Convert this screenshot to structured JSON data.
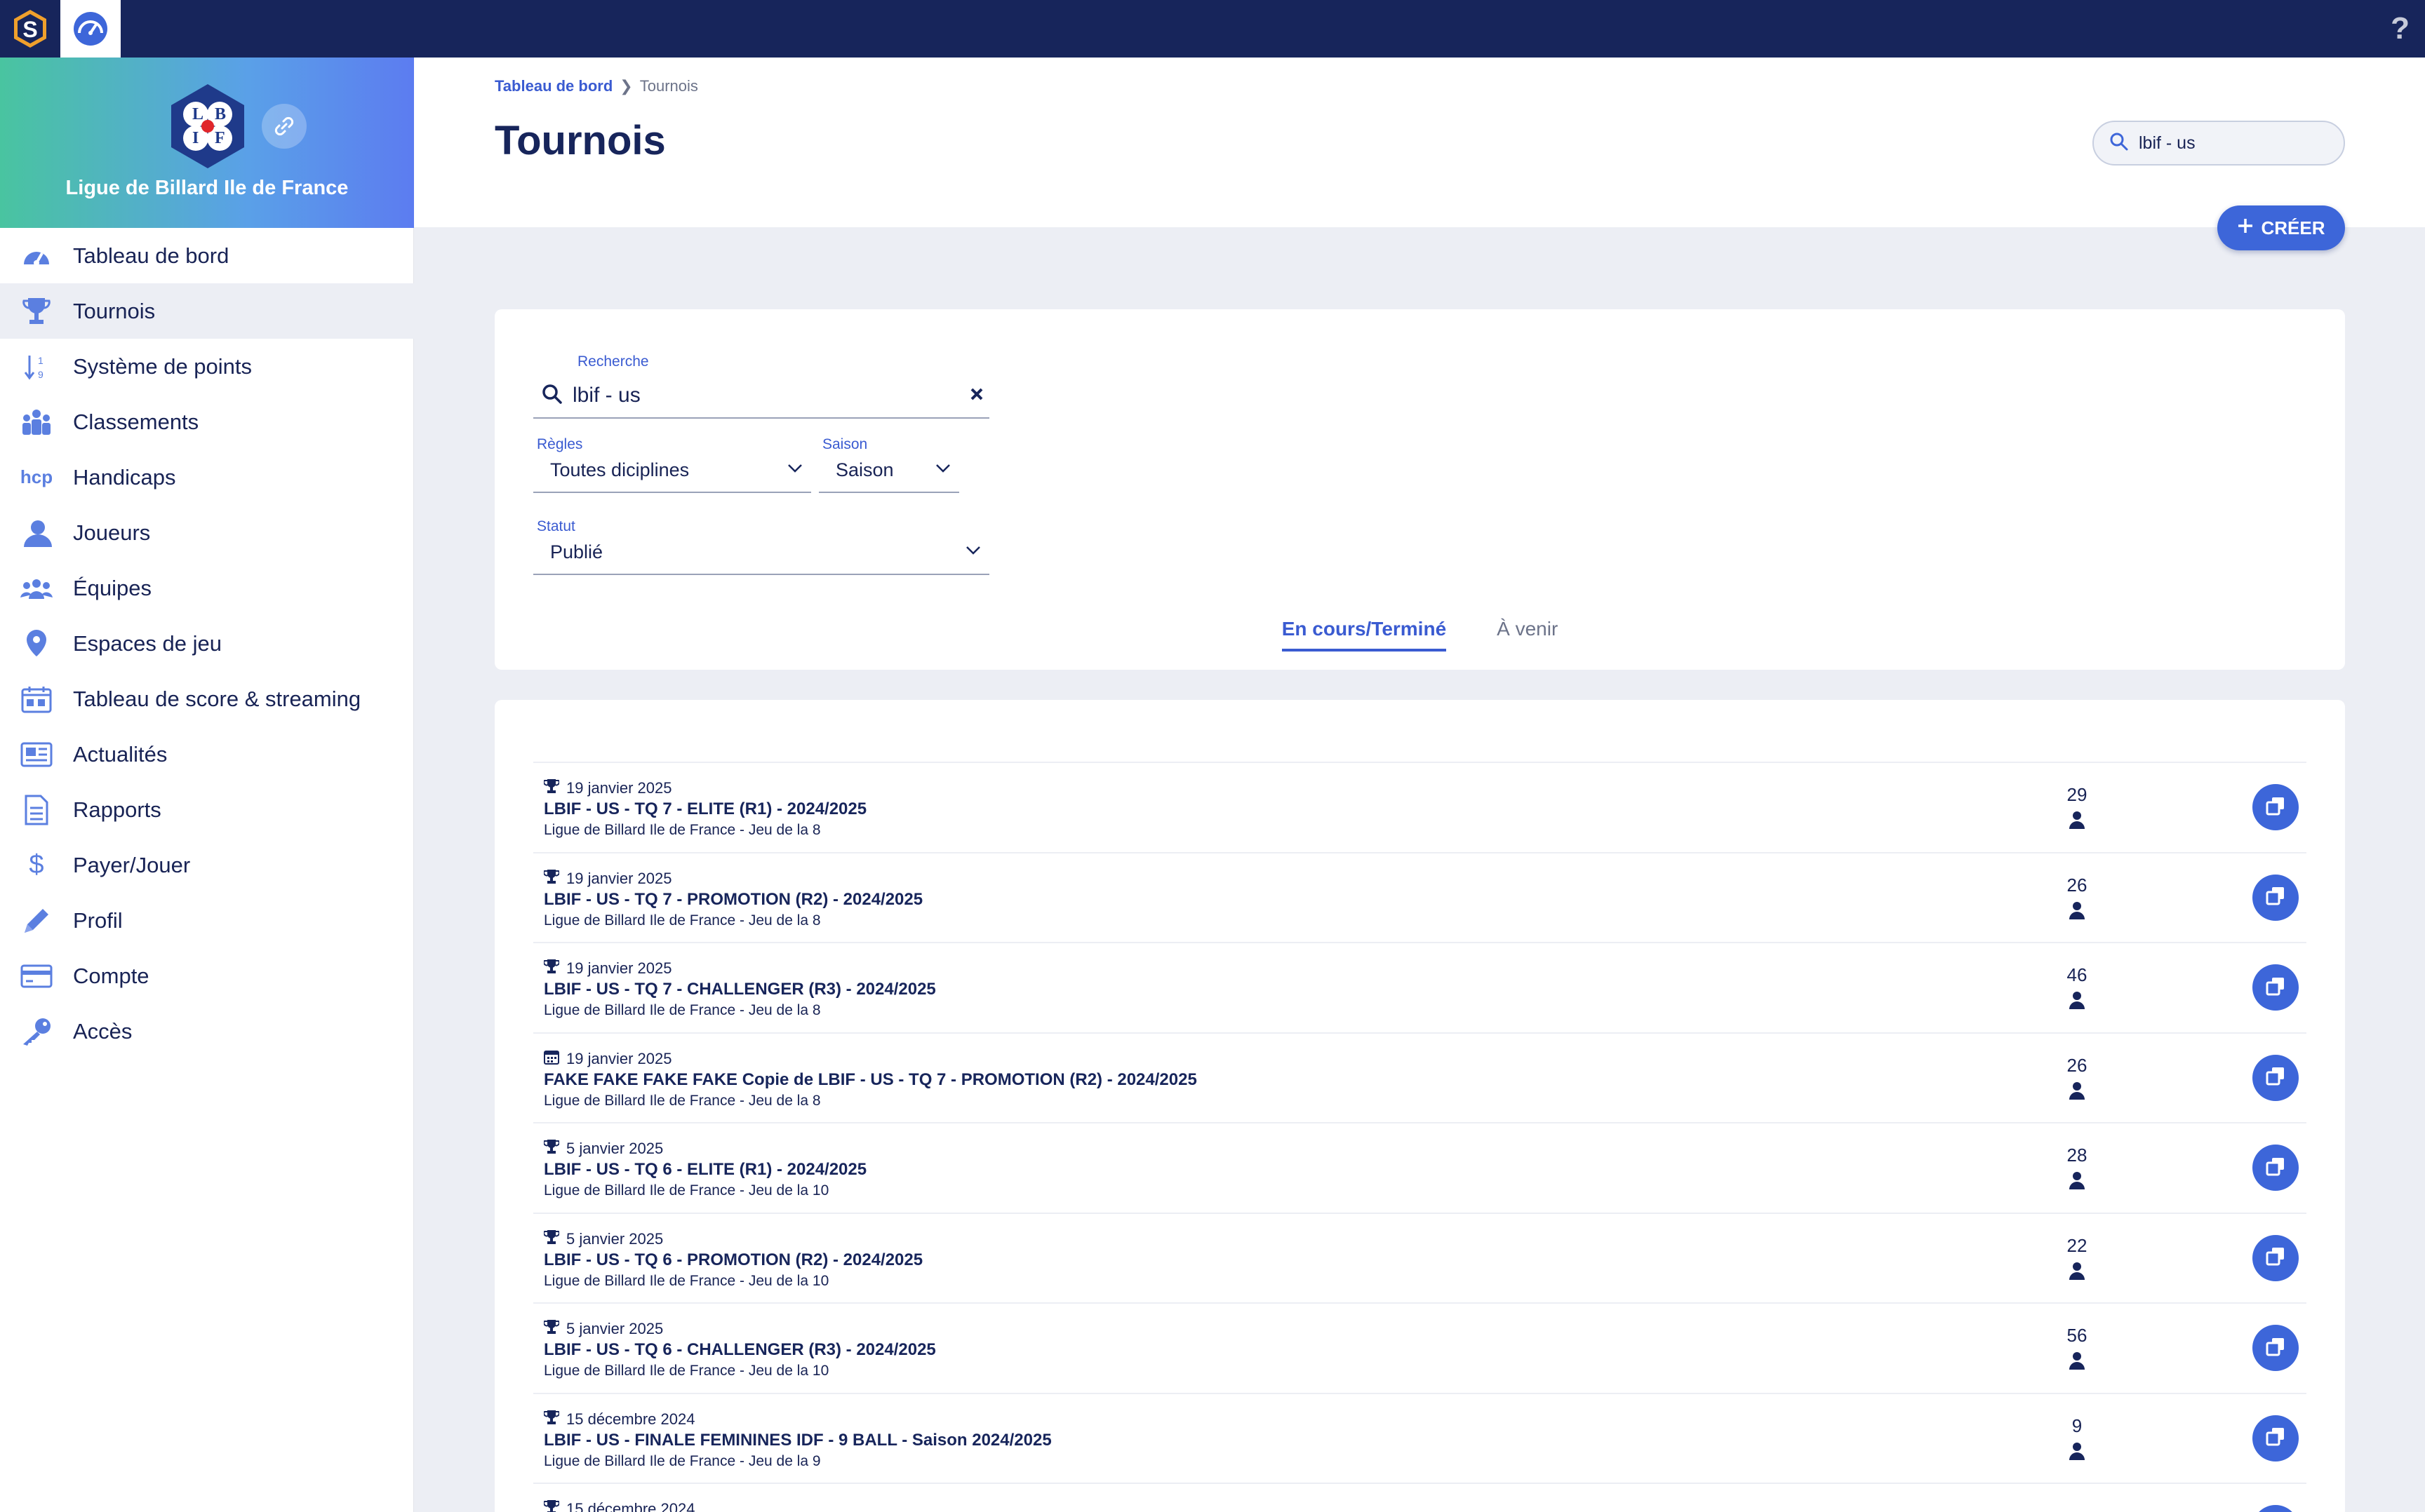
{
  "topbar": {
    "help": "?"
  },
  "org": {
    "name": "Ligue de Billard Ile de France",
    "logo_letters": [
      "L",
      "B",
      "I",
      "F"
    ]
  },
  "nav": [
    {
      "label": "Tableau de bord",
      "icon": "dashboard-icon"
    },
    {
      "label": "Tournois",
      "icon": "trophy-icon",
      "active": true
    },
    {
      "label": "Système de points",
      "icon": "sort-numbers-icon"
    },
    {
      "label": "Classements",
      "icon": "group-icon"
    },
    {
      "label": "Handicaps",
      "icon": "hcp-icon",
      "icon_text": "hcp"
    },
    {
      "label": "Joueurs",
      "icon": "user-icon"
    },
    {
      "label": "Équipes",
      "icon": "team-icon"
    },
    {
      "label": "Espaces de jeu",
      "icon": "location-pin-icon"
    },
    {
      "label": "Tableau de score & streaming",
      "icon": "calendar-icon"
    },
    {
      "label": "Actualités",
      "icon": "newspaper-icon"
    },
    {
      "label": "Rapports",
      "icon": "document-icon"
    },
    {
      "label": "Payer/Jouer",
      "icon": "dollar-icon",
      "icon_text": "$"
    },
    {
      "label": "Profil",
      "icon": "pencil-icon"
    },
    {
      "label": "Compte",
      "icon": "credit-card-icon"
    },
    {
      "label": "Accès",
      "icon": "key-icon"
    }
  ],
  "breadcrumb": {
    "home": "Tableau de bord",
    "separator": "❯",
    "current": "Tournois"
  },
  "page_title": "Tournois",
  "top_search": {
    "value": "lbif - us"
  },
  "create_button": {
    "label": "CRÉER"
  },
  "filters": {
    "search_label": "Recherche",
    "search_value": "lbif - us",
    "rules_label": "Règles",
    "rules_value": "Toutes diciplines",
    "season_label": "Saison",
    "season_value": "Saison",
    "status_label": "Statut",
    "status_value": "Publié"
  },
  "tabs": [
    {
      "label": "En cours/Terminé",
      "active": true
    },
    {
      "label": "À venir",
      "active": false
    }
  ],
  "tournaments": [
    {
      "date": "19 janvier 2025",
      "icon": "trophy-icon",
      "title": "LBIF - US - TQ 7 - ELITE (R1) - 2024/2025",
      "subtitle": "Ligue de Billard Ile de France - Jeu de la 8",
      "players": "29"
    },
    {
      "date": "19 janvier 2025",
      "icon": "trophy-icon",
      "title": "LBIF - US - TQ 7 - PROMOTION (R2) - 2024/2025",
      "subtitle": "Ligue de Billard Ile de France - Jeu de la 8",
      "players": "26"
    },
    {
      "date": "19 janvier 2025",
      "icon": "trophy-icon",
      "title": "LBIF - US - TQ 7 - CHALLENGER (R3) - 2024/2025",
      "subtitle": "Ligue de Billard Ile de France - Jeu de la 8",
      "players": "46"
    },
    {
      "date": "19 janvier 2025",
      "icon": "calendar-icon",
      "title": "FAKE FAKE FAKE FAKE Copie de LBIF - US - TQ 7 - PROMOTION (R2) - 2024/2025",
      "subtitle": "Ligue de Billard Ile de France - Jeu de la 8",
      "players": "26"
    },
    {
      "date": "5 janvier 2025",
      "icon": "trophy-icon",
      "title": "LBIF - US - TQ 6 - ELITE (R1) - 2024/2025",
      "subtitle": "Ligue de Billard Ile de France - Jeu de la 10",
      "players": "28"
    },
    {
      "date": "5 janvier 2025",
      "icon": "trophy-icon",
      "title": "LBIF - US - TQ 6 - PROMOTION (R2) - 2024/2025",
      "subtitle": "Ligue de Billard Ile de France - Jeu de la 10",
      "players": "22"
    },
    {
      "date": "5 janvier 2025",
      "icon": "trophy-icon",
      "title": "LBIF - US - TQ 6 - CHALLENGER (R3) - 2024/2025",
      "subtitle": "Ligue de Billard Ile de France - Jeu de la 10",
      "players": "56"
    },
    {
      "date": "15 décembre 2024",
      "icon": "trophy-icon",
      "title": "LBIF - US - FINALE FEMININES IDF - 9 BALL - Saison 2024/2025",
      "subtitle": "Ligue de Billard Ile de France - Jeu de la 9",
      "players": "9"
    },
    {
      "date": "15 décembre 2024",
      "icon": "trophy-icon",
      "title": "",
      "subtitle": "",
      "players": ""
    }
  ],
  "colors": {
    "navy": "#17255b",
    "accent": "#3d66d9",
    "background": "#eceef4",
    "icon": "#5b7fe0"
  }
}
